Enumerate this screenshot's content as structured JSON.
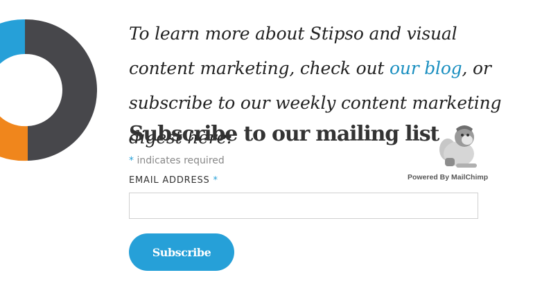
{
  "intro": {
    "before_link": "To learn more about Stipso and visual content marketing, check out ",
    "link_text": "our blog",
    "after_link": ", or subscribe to our weekly content marketing digest here:"
  },
  "form": {
    "heading": "Subscribe to our mailing list",
    "required_asterisk": "*",
    "required_note": " indicates required",
    "email_label": "EMAIL ADDRESS",
    "email_asterisk": "*",
    "email_value": "",
    "subscribe_label": "Subscribe"
  },
  "badge": {
    "text": "Powered By MailChimp",
    "icon": "mailchimp-monkey-icon"
  },
  "colors": {
    "accent": "#26a0d8",
    "link": "#1a8fc0",
    "donut_dark": "#47474b",
    "donut_orange": "#f0861c",
    "donut_blue": "#26a0d8"
  }
}
